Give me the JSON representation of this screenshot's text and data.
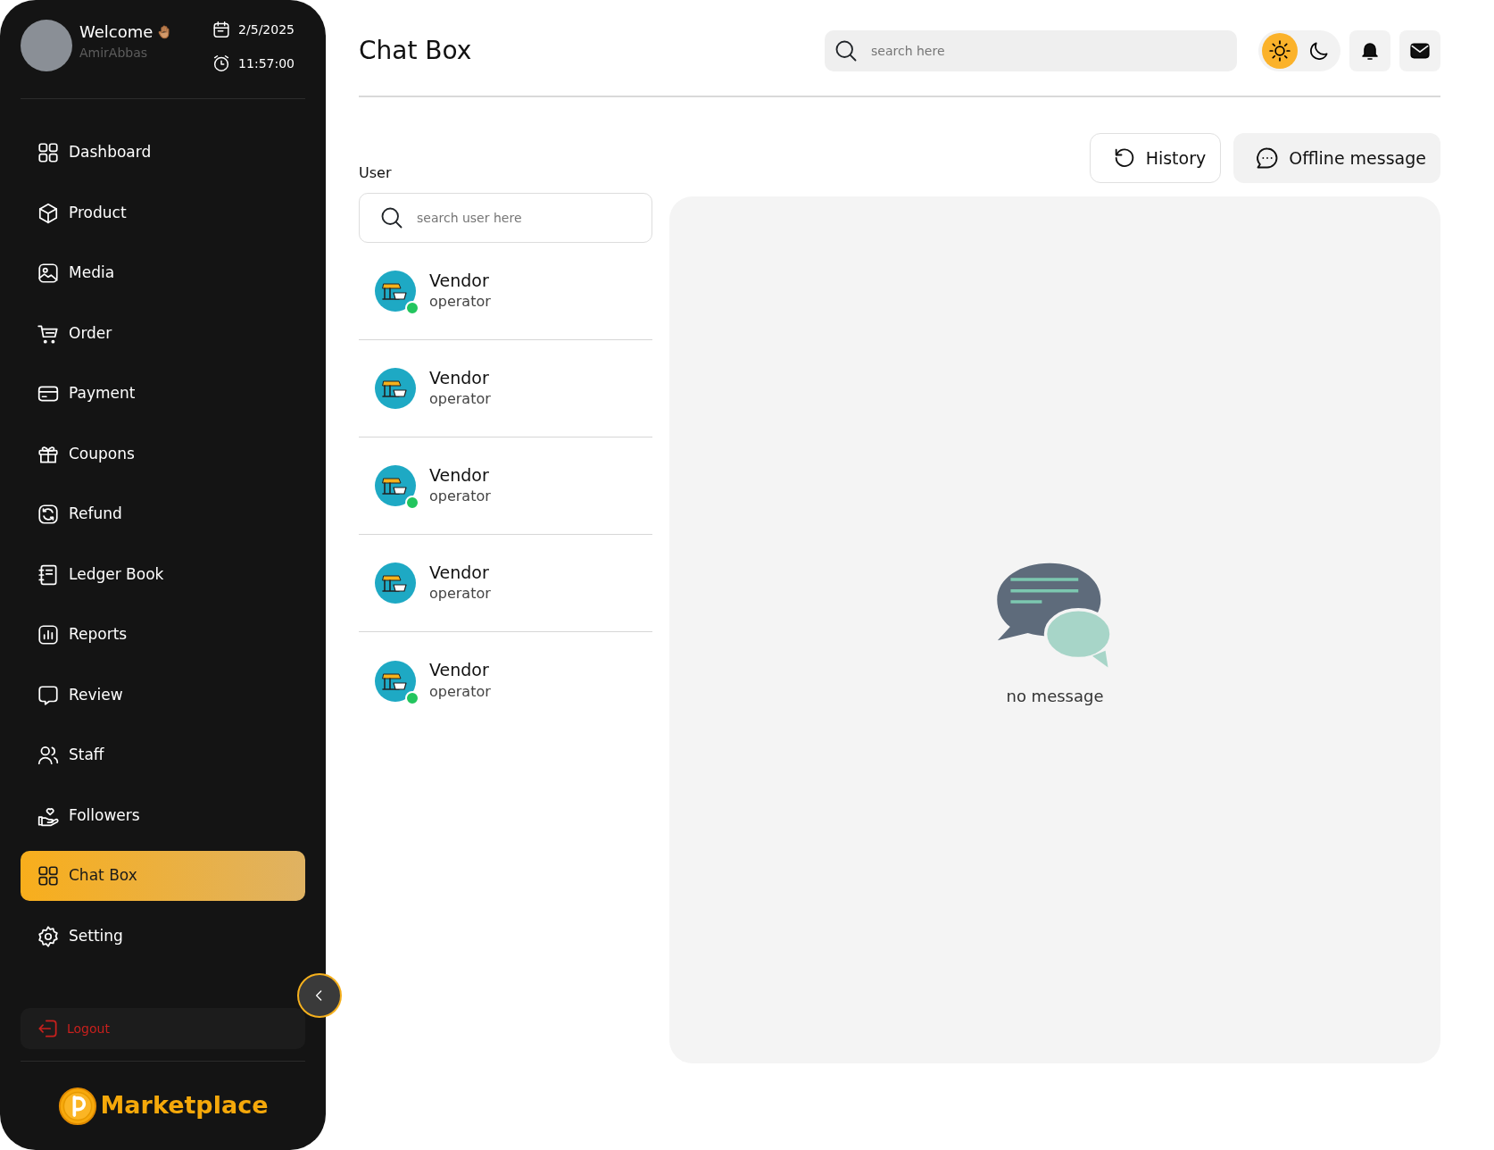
{
  "profile": {
    "greeting": "Welcome",
    "username": "AmirAbbas",
    "date": "2/5/2025",
    "time": "11:57:00"
  },
  "sidebar": {
    "items": [
      {
        "label": "Dashboard",
        "selected": false
      },
      {
        "label": "Product",
        "selected": false
      },
      {
        "label": "Media",
        "selected": false
      },
      {
        "label": "Order",
        "selected": false
      },
      {
        "label": "Payment",
        "selected": false
      },
      {
        "label": "Coupons",
        "selected": false
      },
      {
        "label": "Refund",
        "selected": false
      },
      {
        "label": "Ledger Book",
        "selected": false
      },
      {
        "label": "Reports",
        "selected": false
      },
      {
        "label": "Review",
        "selected": false
      },
      {
        "label": "Staff",
        "selected": false
      },
      {
        "label": "Followers",
        "selected": false
      },
      {
        "label": "Chat Box",
        "selected": true
      },
      {
        "label": "Setting",
        "selected": false
      }
    ],
    "logout": "Logout",
    "brand": "Marketplace"
  },
  "header": {
    "title": "Chat Box",
    "search": {
      "placeholder": "search here"
    },
    "theme": [
      {
        "kind": "light",
        "selected": true
      },
      {
        "kind": "dark",
        "selected": false
      }
    ]
  },
  "actions": [
    "History",
    "Offline message"
  ],
  "users": {
    "label": "User",
    "search": {
      "placeholder": "search user here"
    },
    "list": [
      {
        "name": "Vendor",
        "role": "operator",
        "online": true
      },
      {
        "name": "Vendor",
        "role": "operator",
        "online": false
      },
      {
        "name": "Vendor",
        "role": "operator",
        "online": true
      },
      {
        "name": "Vendor",
        "role": "operator",
        "online": false
      },
      {
        "name": "Vendor",
        "role": "operator",
        "online": true
      }
    ]
  },
  "chat": {
    "empty_text": "no message"
  }
}
